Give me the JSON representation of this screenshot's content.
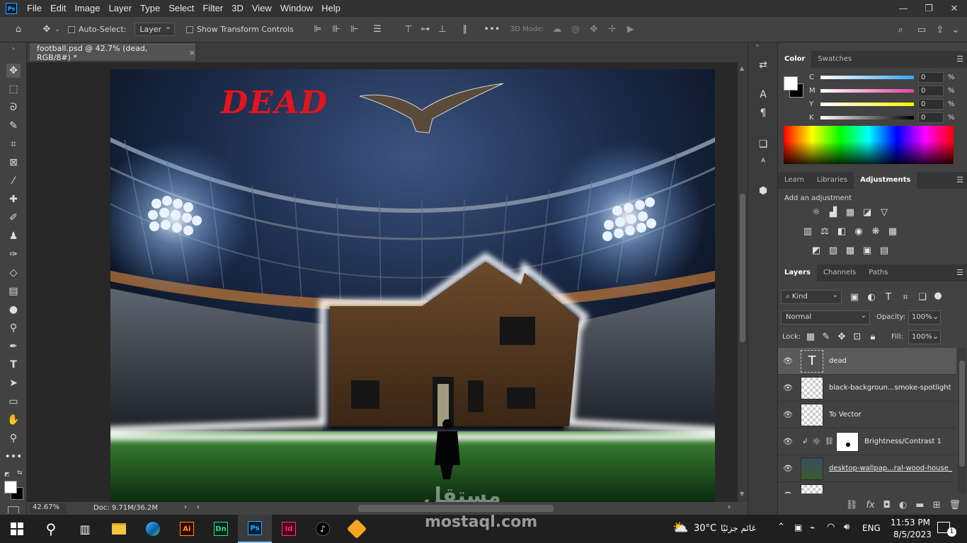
{
  "app": {
    "logo": "Ps",
    "menus": [
      "File",
      "Edit",
      "Image",
      "Layer",
      "Type",
      "Select",
      "Filter",
      "3D",
      "View",
      "Window",
      "Help"
    ]
  },
  "options": {
    "auto_select_label": "Auto-Select:",
    "auto_select_value": "Layer",
    "transform_label": "Show Transform Controls",
    "mode_label": "3D Mode:"
  },
  "document": {
    "tab_title": "football.psd @ 42.7% (dead, RGB/8#) *",
    "artwork_text": "DEAD",
    "zoom": "42.67%",
    "doc_size": "Doc: 9.71M/36.2M"
  },
  "color_panel": {
    "tabs": [
      "Color",
      "Swatches"
    ],
    "sliders": [
      {
        "label": "C",
        "value": "0",
        "gradient": "#31a8ff"
      },
      {
        "label": "M",
        "value": "0",
        "gradient": "#e8419a"
      },
      {
        "label": "Y",
        "value": "0",
        "gradient": "#fff200"
      },
      {
        "label": "K",
        "value": "0",
        "gradient": "#000000"
      }
    ],
    "percent": "%"
  },
  "adjust_panel": {
    "tabs": [
      "Learn",
      "Libraries",
      "Adjustments"
    ],
    "heading": "Add an adjustment"
  },
  "layers_panel": {
    "tabs": [
      "Layers",
      "Channels",
      "Paths"
    ],
    "filter_kind": "Kind",
    "blend_mode": "Normal",
    "opacity_label": "Opacity:",
    "opacity_value": "100%",
    "lock_label": "Lock:",
    "fill_label": "Fill:",
    "fill_value": "100%",
    "layers": [
      {
        "name": "dead",
        "type": "text"
      },
      {
        "name": "black-backgroun...smoke-spotlight",
        "type": "smart"
      },
      {
        "name": "To Vector",
        "type": "pixel"
      },
      {
        "name": "Brightness/Contrast 1",
        "type": "adjustment"
      },
      {
        "name": "desktop-wallpap...ral-wood-house_",
        "type": "smart"
      },
      {
        "name": "",
        "type": "pixel"
      }
    ]
  },
  "taskbar": {
    "weather_temp": "30°C",
    "weather_text": "غائم جزئيًا",
    "language": "ENG",
    "time": "11:53 PM",
    "date": "8/5/2023",
    "notifications": "1"
  },
  "watermark": {
    "arabic": "مستقل",
    "latin": "mostaql.com"
  },
  "colors": {
    "accent": "#31a8ff",
    "dead_text": "#e3141c"
  }
}
